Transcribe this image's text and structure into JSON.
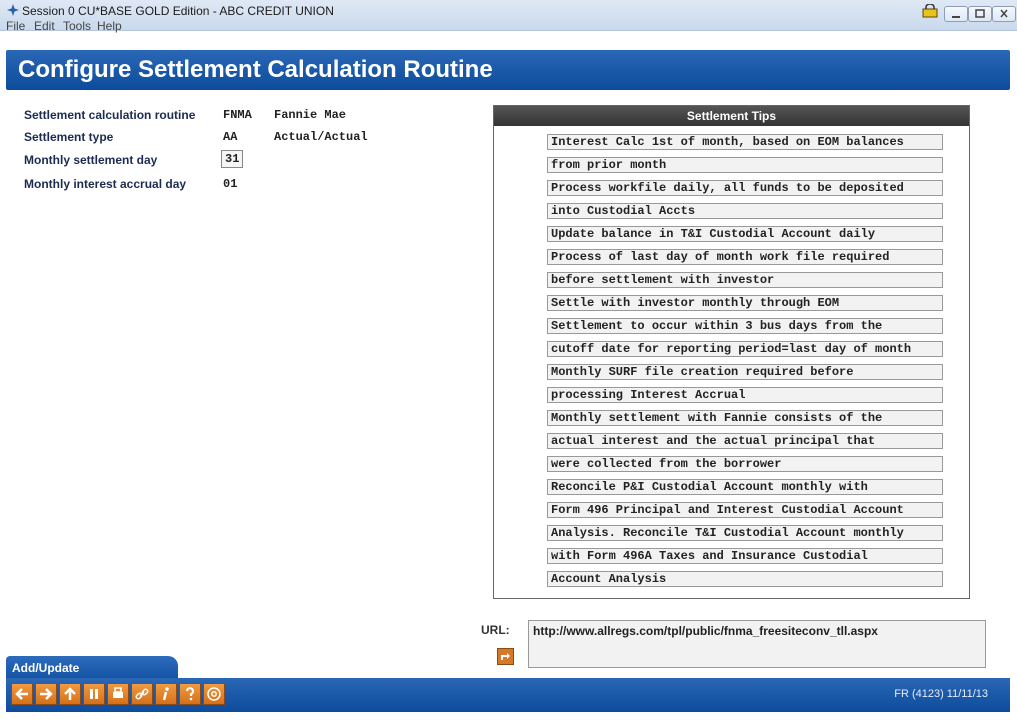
{
  "window": {
    "title": "Session 0 CU*BASE GOLD Edition - ABC CREDIT UNION",
    "menu": [
      "File",
      "Edit",
      "Tools",
      "Help"
    ]
  },
  "page": {
    "title": "Configure Settlement Calculation Routine"
  },
  "fields": {
    "routine": {
      "label": "Settlement calculation routine",
      "code": "FNMA",
      "desc": "Fannie Mae"
    },
    "type": {
      "label": "Settlement type",
      "code": "AA",
      "desc": "Actual/Actual"
    },
    "settlement_day": {
      "label": "Monthly settlement day",
      "value": "31"
    },
    "accrual_day": {
      "label": "Monthly interest accrual day",
      "value": "01"
    }
  },
  "tips": {
    "header": "Settlement Tips",
    "lines": [
      "Interest Calc 1st of month, based on EOM balances",
      "from prior month",
      "Process workfile daily, all funds to be deposited",
      "into Custodial Accts",
      "Update balance in T&I Custodial Account daily",
      "Process of last day of month work file required",
      "before settlement with investor",
      "Settle with investor monthly through EOM",
      "Settlement to occur within 3 bus days from the",
      "cutoff date for reporting period=last day of month",
      "Monthly SURF file creation required before",
      "processing Interest Accrual",
      "Monthly settlement with Fannie consists of the",
      "actual interest and the actual principal that",
      "were collected from the borrower",
      "Reconcile P&I Custodial Account monthly with",
      "Form 496 Principal and Interest Custodial Account",
      "Analysis.  Reconcile T&I Custodial Account monthly",
      "with Form 496A Taxes and Insurance Custodial",
      "Account Analysis"
    ]
  },
  "url": {
    "label": "URL:",
    "value": "http://www.allregs.com/tpl/public/fnma_freesiteconv_tll.aspx"
  },
  "tab": {
    "label": "Add/Update"
  },
  "footer": {
    "info": "FR (4123) 11/11/13",
    "buttons": [
      "back-arrow-icon",
      "forward-arrow-icon",
      "up-arrow-icon",
      "pause-icon",
      "print-icon",
      "link-icon",
      "info-icon",
      "help-icon",
      "at-icon"
    ]
  },
  "colors": {
    "header_blue": "#0d4b9c",
    "button_orange": "#d5701a",
    "tips_header": "#333333"
  }
}
